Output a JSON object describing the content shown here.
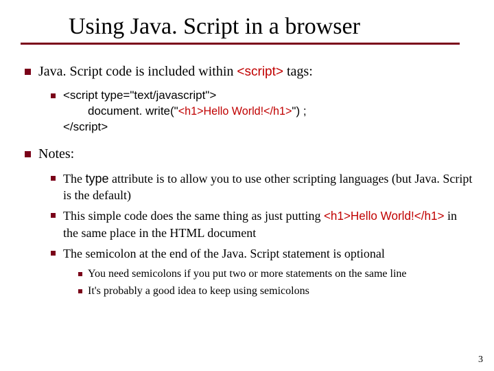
{
  "title": "Using Java. Script in a browser",
  "intro_before": "Java. Script code is included within ",
  "intro_code": "<script>",
  "intro_after": " tags:",
  "code": {
    "open_tag": "<script type=\"text/javascript\">",
    "body_prefix": "document. write(\"",
    "body_html": "<h1>Hello World!</h1>",
    "body_suffix": "\") ;",
    "close_tag": "</script>"
  },
  "notes_label": "Notes:",
  "notes": {
    "type_attr_before": "The ",
    "type_attr_code": "type",
    "type_attr_after": " attribute is to allow you to use other scripting languages (but Java. Script is the default)",
    "simple_before": "This simple code does the same thing as just putting ",
    "simple_code": "<h1>Hello World!</h1>",
    "simple_after": " in the same place in the HTML document",
    "semicolon": "The semicolon at the end of the Java. Script statement is optional",
    "sub1": "You need semicolons if you put two or more statements on the same line",
    "sub2": "It's probably a good idea to keep using semicolons"
  },
  "page_number": "3"
}
